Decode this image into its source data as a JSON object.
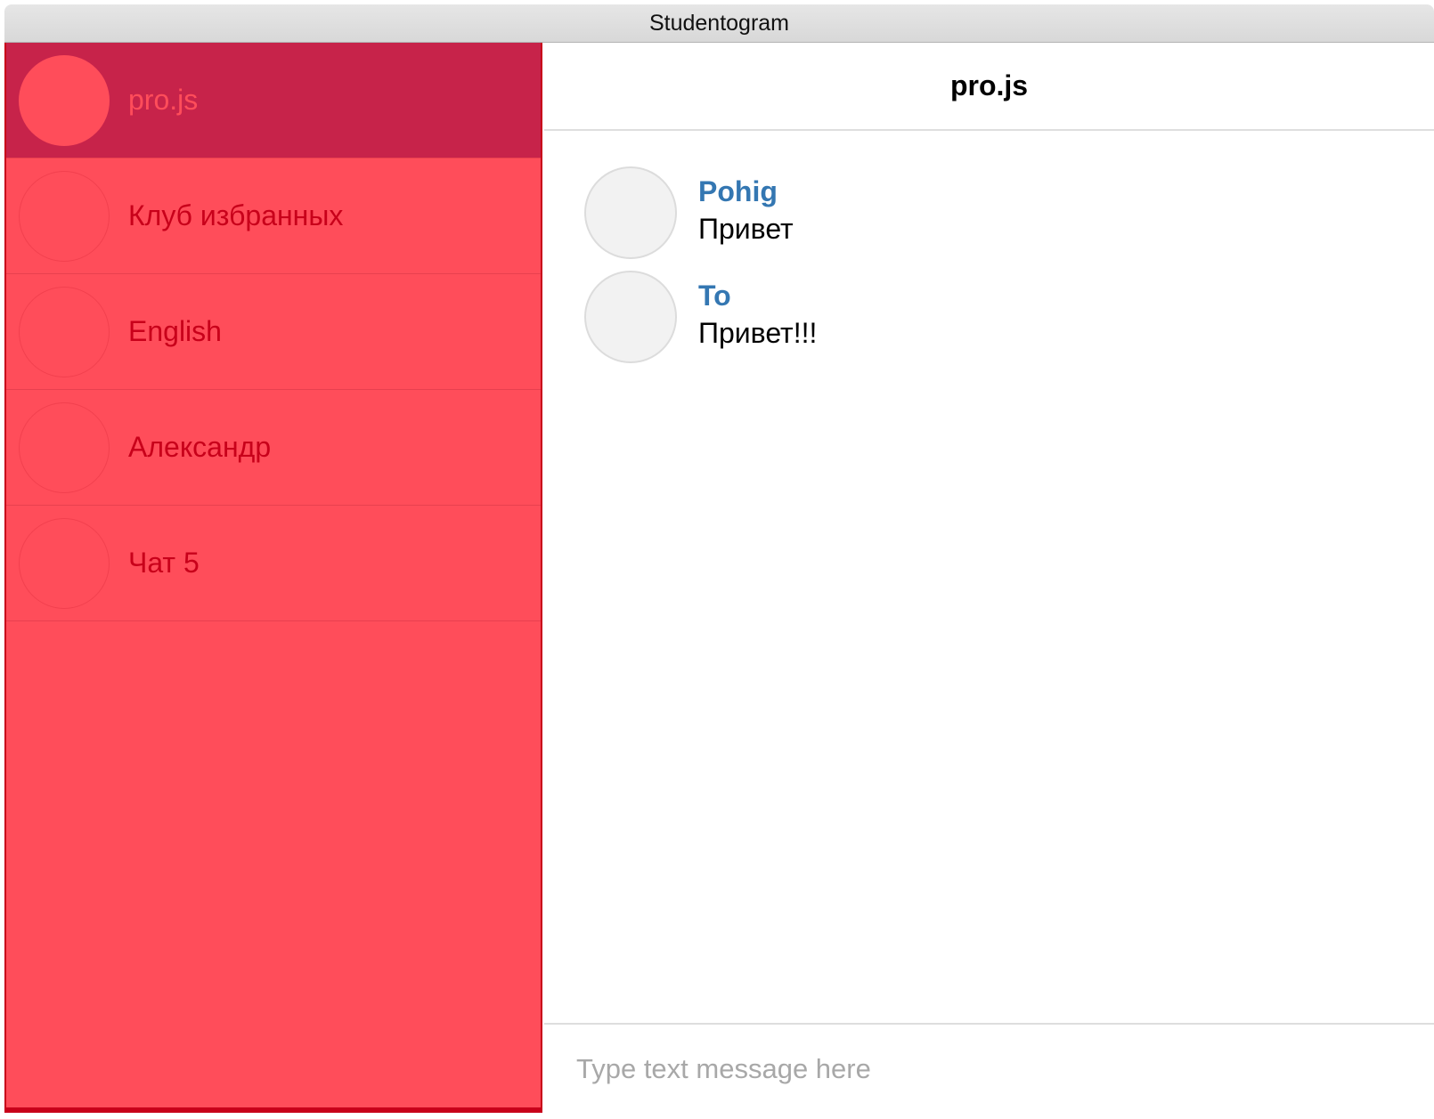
{
  "window": {
    "title": "Studentogram"
  },
  "sidebar": {
    "items": [
      {
        "label": "pro.js",
        "active": true
      },
      {
        "label": "Клуб избранных",
        "active": false
      },
      {
        "label": "English",
        "active": false
      },
      {
        "label": "Александр",
        "active": false
      },
      {
        "label": "Чат 5",
        "active": false
      }
    ]
  },
  "chat": {
    "title": "pro.js",
    "messages": [
      {
        "author": "Pohig",
        "text": "Привет"
      },
      {
        "author": "To",
        "text": "Привет!!!"
      }
    ]
  },
  "composer": {
    "placeholder": "Type text message here",
    "value": ""
  },
  "colors": {
    "sidebar_bg": "#ff4d5a",
    "sidebar_active_bg": "#c7234a",
    "sidebar_text": "#c8001a",
    "author_text": "#3477b2"
  }
}
